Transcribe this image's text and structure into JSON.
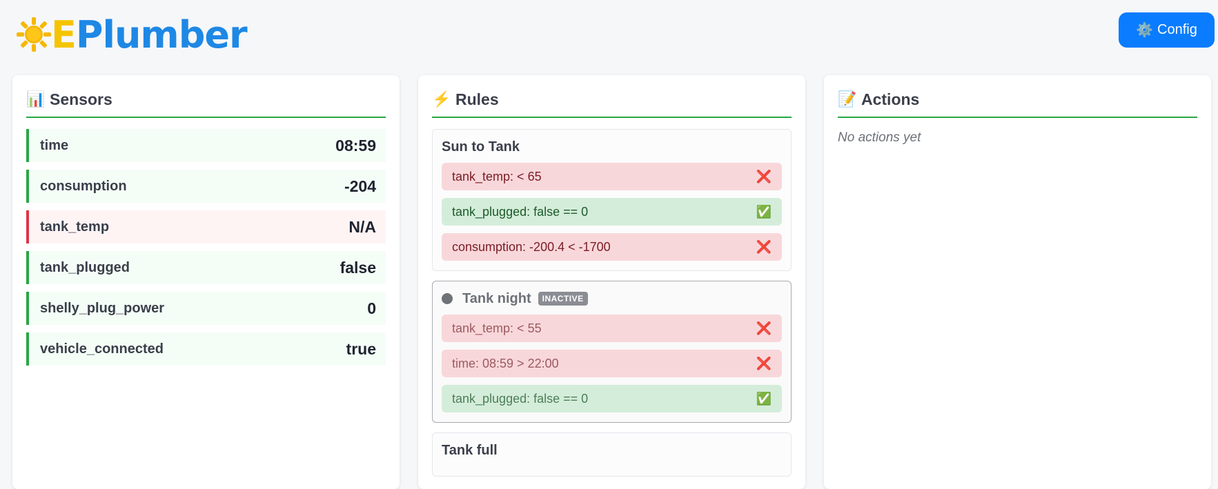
{
  "brand": {
    "first_letter": "E",
    "rest": "Plumber",
    "icon": "sun-icon"
  },
  "config_button": {
    "label": "Config",
    "icon": "gear-icon"
  },
  "sensors": {
    "title": "Sensors",
    "icon": "chart-icon",
    "items": [
      {
        "name": "time",
        "value": "08:59",
        "status": "ok"
      },
      {
        "name": "consumption",
        "value": "-204",
        "status": "ok"
      },
      {
        "name": "tank_temp",
        "value": "N/A",
        "status": "error"
      },
      {
        "name": "tank_plugged",
        "value": "false",
        "status": "ok"
      },
      {
        "name": "shelly_plug_power",
        "value": "0",
        "status": "ok"
      },
      {
        "name": "vehicle_connected",
        "value": "true",
        "status": "ok"
      }
    ]
  },
  "rules": {
    "title": "Rules",
    "icon": "lightning-icon",
    "items": [
      {
        "name": "Sun to Tank",
        "conditions": [
          {
            "text": "tank_temp: < 65",
            "result": "fail"
          },
          {
            "text": "tank_plugged: false == 0",
            "result": "pass"
          },
          {
            "text": "consumption: -200.4 < -1700",
            "result": "fail"
          }
        ]
      },
      {
        "name": "Tank night",
        "badge": "INACTIVE",
        "conditions": [
          {
            "text": "tank_temp: < 55",
            "result": "fail"
          },
          {
            "text": "time: 08:59 > 22:00",
            "result": "fail"
          },
          {
            "text": "tank_plugged: false == 0",
            "result": "pass"
          }
        ]
      },
      {
        "name": "Tank full"
      }
    ]
  },
  "actions": {
    "title": "Actions",
    "icon": "memo-icon",
    "empty_text": "No actions yet"
  },
  "colors": {
    "accent": "#0a7cff",
    "ok": "#28a745",
    "error": "#dc3545",
    "brand_yellow": "#f5c400",
    "brand_blue": "#1e88e5"
  }
}
